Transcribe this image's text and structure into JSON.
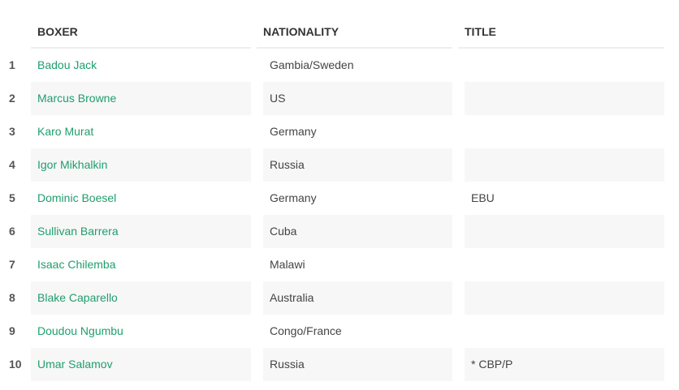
{
  "headers": {
    "boxer": "BOXER",
    "nationality": "NATIONALITY",
    "title": "TITLE"
  },
  "rows": [
    {
      "rank": "1",
      "boxer": "Badou Jack",
      "nationality": "Gambia/Sweden",
      "title": ""
    },
    {
      "rank": "2",
      "boxer": "Marcus Browne",
      "nationality": "US",
      "title": ""
    },
    {
      "rank": "3",
      "boxer": "Karo Murat",
      "nationality": "Germany",
      "title": ""
    },
    {
      "rank": "4",
      "boxer": "Igor Mikhalkin",
      "nationality": "Russia",
      "title": ""
    },
    {
      "rank": "5",
      "boxer": "Dominic Boesel",
      "nationality": "Germany",
      "title": "EBU"
    },
    {
      "rank": "6",
      "boxer": "Sullivan Barrera",
      "nationality": "Cuba",
      "title": ""
    },
    {
      "rank": "7",
      "boxer": "Isaac Chilemba",
      "nationality": "Malawi",
      "title": ""
    },
    {
      "rank": "8",
      "boxer": "Blake Caparello",
      "nationality": "Australia",
      "title": ""
    },
    {
      "rank": "9",
      "boxer": "Doudou Ngumbu",
      "nationality": "Congo/France",
      "title": ""
    },
    {
      "rank": "10",
      "boxer": "Umar Salamov",
      "nationality": "Russia",
      "title": "* CBP/P"
    }
  ],
  "colors": {
    "link": "#1f9e6e",
    "stripe": "#f7f7f7",
    "header_border": "#eeeeee"
  }
}
